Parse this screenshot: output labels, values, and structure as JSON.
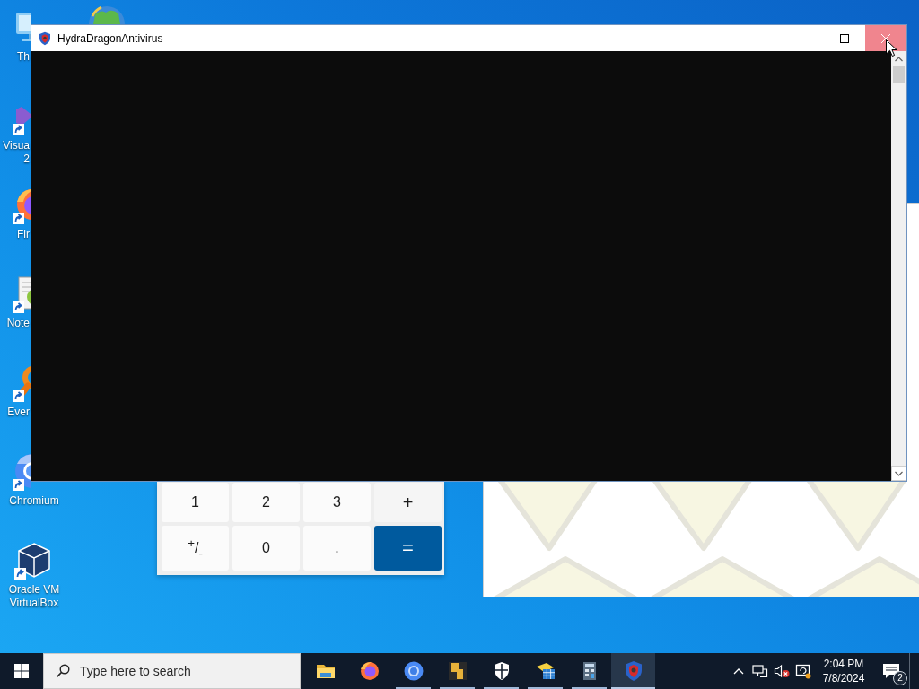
{
  "desktop": {
    "icons": [
      {
        "label": [
          "Th"
        ],
        "kind": "monitor",
        "icon_covered": true,
        "label_covered": true,
        "shortcut": false
      },
      {
        "label": [
          "Visua",
          "2"
        ],
        "kind": "ribbon",
        "icon_covered": true,
        "label_covered": true,
        "shortcut": true
      },
      {
        "label": [
          "Fir"
        ],
        "kind": "fox",
        "icon_covered": true,
        "label_covered": true,
        "shortcut": true
      },
      {
        "label": [
          "Note"
        ],
        "kind": "notepad",
        "icon_covered": true,
        "label_covered": true,
        "shortcut": true
      },
      {
        "label": [
          "Ever"
        ],
        "kind": "magnifier",
        "icon_covered": true,
        "label_covered": true,
        "shortcut": true
      },
      {
        "label": [
          "Chromium"
        ],
        "kind": "ring",
        "icon_covered": true,
        "label_covered": false,
        "shortcut": true
      },
      {
        "label": [
          "Oracle VM",
          "VirtualBox"
        ],
        "kind": "cube",
        "icon_covered": false,
        "label_covered": false,
        "shortcut": true
      }
    ]
  },
  "window": {
    "title": "HydraDragonAntivirus",
    "controls": [
      {
        "kind": "minimize",
        "hovered": false
      },
      {
        "kind": "maximize",
        "hovered": false
      },
      {
        "kind": "close",
        "hovered": true
      }
    ]
  },
  "calculator": {
    "keys": [
      {
        "label": "1",
        "kind": "plain"
      },
      {
        "label": "2",
        "kind": "plain"
      },
      {
        "label": "3",
        "kind": "plain"
      },
      {
        "label": "+",
        "kind": "operator"
      },
      {
        "label": "$^{+}$/$_{-}$",
        "kind": "plain"
      },
      {
        "label": "0",
        "kind": "plain"
      },
      {
        "label": ".",
        "kind": "plain"
      },
      {
        "label": "=",
        "kind": "equals"
      }
    ]
  },
  "taskbar": {
    "search": {
      "placeholder": "Type here to search"
    },
    "apps": [
      {
        "kind": "folder",
        "running": false,
        "selected": false
      },
      {
        "kind": "fox",
        "running": false,
        "selected": false
      },
      {
        "kind": "ring",
        "running": true,
        "selected": false
      },
      {
        "kind": "blocks",
        "running": true,
        "selected": false
      },
      {
        "kind": "shield",
        "running": true,
        "selected": false
      },
      {
        "kind": "grid",
        "running": true,
        "selected": false
      },
      {
        "kind": "calculator",
        "running": true,
        "selected": false
      },
      {
        "kind": "crest",
        "running": true,
        "selected": true
      }
    ],
    "clock": {
      "time": "2:04 PM",
      "date": "7/8/2024"
    },
    "notifications": {
      "count": "2"
    }
  }
}
